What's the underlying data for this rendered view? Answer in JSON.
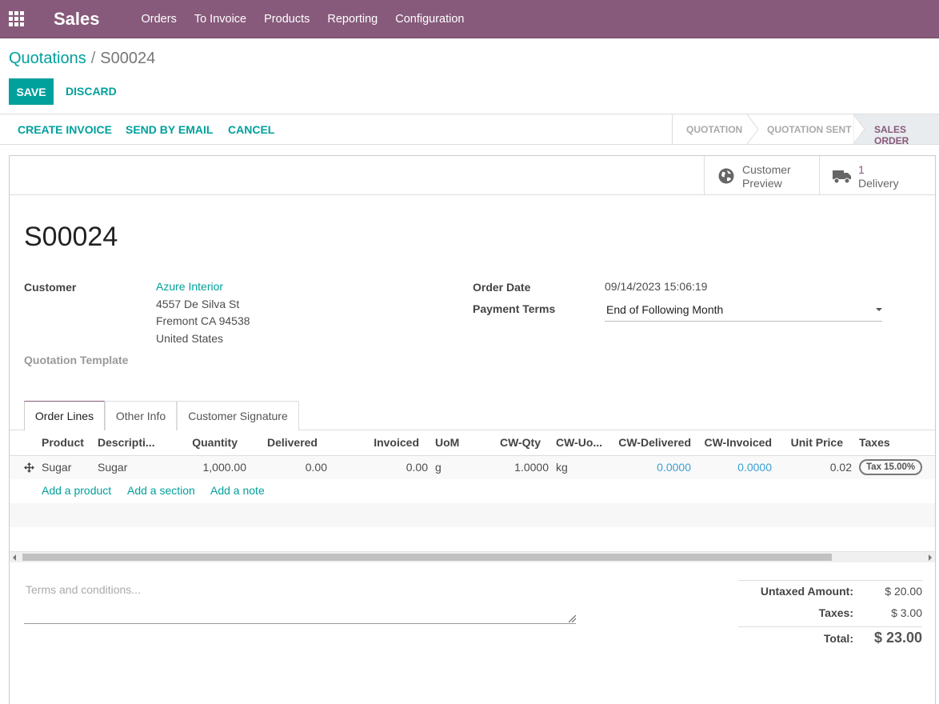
{
  "app": {
    "name": "Sales",
    "menu": [
      "Orders",
      "To Invoice",
      "Products",
      "Reporting",
      "Configuration"
    ]
  },
  "breadcrumb": {
    "parent": "Quotations",
    "separator": "/",
    "current": "S00024"
  },
  "buttons": {
    "save": "SAVE",
    "discard": "DISCARD"
  },
  "actions": [
    "CREATE INVOICE",
    "SEND BY EMAIL",
    "CANCEL"
  ],
  "stages": [
    {
      "label": "QUOTATION",
      "active": false
    },
    {
      "label": "QUOTATION SENT",
      "active": false
    },
    {
      "label": "SALES ORDER",
      "active": true
    }
  ],
  "smart_buttons": {
    "preview": {
      "line1": "Customer",
      "line2": "Preview",
      "icon": "globe-icon"
    },
    "delivery": {
      "count": "1",
      "label": "Delivery",
      "icon": "truck-icon"
    }
  },
  "record": {
    "name": "S00024",
    "customer_label": "Customer",
    "customer_name": "Azure Interior",
    "address1": "4557 De Silva St",
    "address2": "Fremont CA 94538",
    "address3": "United States",
    "template_label": "Quotation Template",
    "order_date_label": "Order Date",
    "order_date": "09/14/2023 15:06:19",
    "payment_terms_label": "Payment Terms",
    "payment_terms": "End of Following Month"
  },
  "tabs": [
    {
      "label": "Order Lines",
      "active": true
    },
    {
      "label": "Other Info",
      "active": false
    },
    {
      "label": "Customer Signature",
      "active": false
    }
  ],
  "order_lines": {
    "columns": [
      "Product",
      "Descripti...",
      "Quantity",
      "Delivered",
      "Invoiced",
      "UoM",
      "CW-Qty",
      "CW-Uo...",
      "CW-Delivered",
      "CW-Invoiced",
      "Unit Price",
      "Taxes"
    ],
    "rows": [
      {
        "product": "Sugar",
        "description": "Sugar",
        "quantity": "1,000.00",
        "delivered": "0.00",
        "invoiced": "0.00",
        "uom": "g",
        "cw_qty": "1.0000",
        "cw_uom": "kg",
        "cw_delivered": "0.0000",
        "cw_invoiced": "0.0000",
        "unit_price": "0.02",
        "taxes": "Tax 15.00%"
      }
    ],
    "add_links": [
      "Add a product",
      "Add a section",
      "Add a note"
    ]
  },
  "terms_placeholder": "Terms and conditions...",
  "totals": {
    "untaxed_label": "Untaxed Amount:",
    "untaxed": "$ 20.00",
    "taxes_label": "Taxes:",
    "taxes": "$ 3.00",
    "total_label": "Total:",
    "total": "$ 23.00"
  },
  "colors": {
    "brand": "#875a7b",
    "accent": "#00a09d",
    "link_blue": "#3b9fd1"
  }
}
